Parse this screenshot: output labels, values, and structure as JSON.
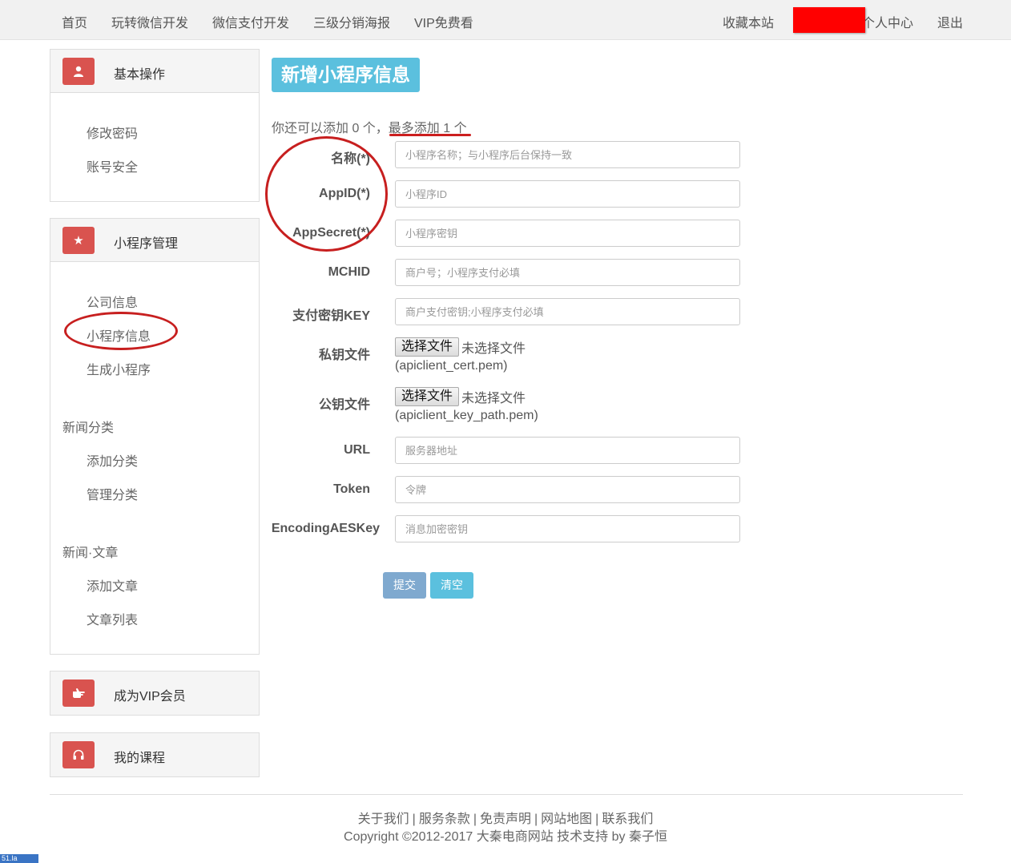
{
  "nav": {
    "home": "首页",
    "wechat_dev": "玩转微信开发",
    "wechat_pay": "微信支付开发",
    "poster": "三级分销海报",
    "vip": "VIP免费看",
    "bookmark": "收藏本站",
    "user_center": "个人中心",
    "logout": "退出"
  },
  "sidebar": {
    "basic": {
      "title": "基本操作",
      "icon": "user-icon",
      "items": [
        "修改密码",
        "账号安全"
      ]
    },
    "miniapp": {
      "title": "小程序管理",
      "icon": "star-icon",
      "items": [
        "公司信息",
        "小程序信息",
        "生成小程序"
      ],
      "groups": [
        {
          "title": "新闻分类",
          "items": [
            "添加分类",
            "管理分类"
          ]
        },
        {
          "title": "新闻·文章",
          "items": [
            "添加文章",
            "文章列表"
          ]
        }
      ]
    },
    "vip": {
      "title": "成为VIP会员",
      "icon": "hand-point-icon"
    },
    "courses": {
      "title": "我的课程",
      "icon": "headphones-icon"
    }
  },
  "main": {
    "title": "新增小程序信息",
    "quota_text": "你还可以添加 0 个，最多添加 1 个",
    "fields": {
      "name": {
        "label": "名称(*)",
        "placeholder": "小程序名称；与小程序后台保持一致"
      },
      "appid": {
        "label": "AppID(*)",
        "placeholder": "小程序ID"
      },
      "appsecret": {
        "label": "AppSecret(*)",
        "placeholder": "小程序密钥"
      },
      "mchid": {
        "label": "MCHID",
        "placeholder": "商户号；小程序支付必填"
      },
      "paykey": {
        "label": "支付密钥KEY",
        "placeholder": "商户支付密钥;小程序支付必填"
      },
      "private_key": {
        "label": "私钥文件",
        "button": "选择文件",
        "status": "未选择文件",
        "hint": "(apiclient_cert.pem)"
      },
      "public_key": {
        "label": "公钥文件",
        "button": "选择文件",
        "status": "未选择文件",
        "hint": "(apiclient_key_path.pem)"
      },
      "url": {
        "label": "URL",
        "placeholder": "服务器地址"
      },
      "token": {
        "label": "Token",
        "placeholder": "令牌"
      },
      "aeskey": {
        "label": "EncodingAESKey",
        "placeholder": "消息加密密钥"
      }
    },
    "submit": "提交",
    "clear": "清空"
  },
  "footer": {
    "links": [
      "关于我们",
      "服务条款",
      "免责声明",
      "网站地图",
      "联系我们"
    ],
    "separator": "|",
    "copyright": "Copyright ©2012-2017 大秦电商网站 技术支持 by 秦子恒"
  },
  "stat_badge": "51.la"
}
